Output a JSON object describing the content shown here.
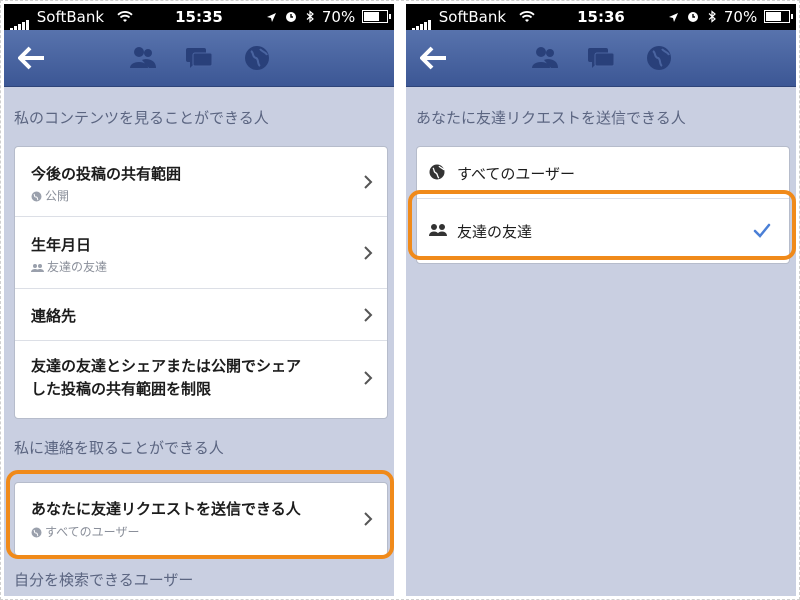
{
  "statusbar_left": {
    "carrier": "SoftBank",
    "time": "15:35",
    "battery": "70%",
    "battery_level": 0.7
  },
  "statusbar_right": {
    "carrier": "SoftBank",
    "time": "15:36",
    "battery": "70%",
    "battery_level": 0.7
  },
  "left": {
    "section1": "私のコンテンツを見ることができる人",
    "items": [
      {
        "title": "今後の投稿の共有範囲",
        "sub": "公開",
        "sub_icon": "globe-icon"
      },
      {
        "title": "生年月日",
        "sub": "友達の友達",
        "sub_icon": "friends-icon"
      },
      {
        "title": "連絡先"
      },
      {
        "title_line1": "友達の友達とシェアまたは公開でシェア",
        "title_line2": "した投稿の共有範囲を制限"
      }
    ],
    "section2": "私に連絡を取ることができる人",
    "friend_request": {
      "title": "あなたに友達リクエストを送信できる人",
      "sub": "すべてのユーザー"
    },
    "section3": "自分を検索できるユーザー"
  },
  "right": {
    "section1": "あなたに友達リクエストを送信できる人",
    "options": [
      {
        "label": "すべてのユーザー",
        "icon": "globe-icon",
        "selected": false
      },
      {
        "label": "友達の友達",
        "icon": "friends-icon",
        "selected": true
      }
    ]
  },
  "colors": {
    "navbar": "#3c5795",
    "background": "#c9cfe1",
    "highlight": "#f08a1a",
    "check": "#4a7fd6"
  }
}
